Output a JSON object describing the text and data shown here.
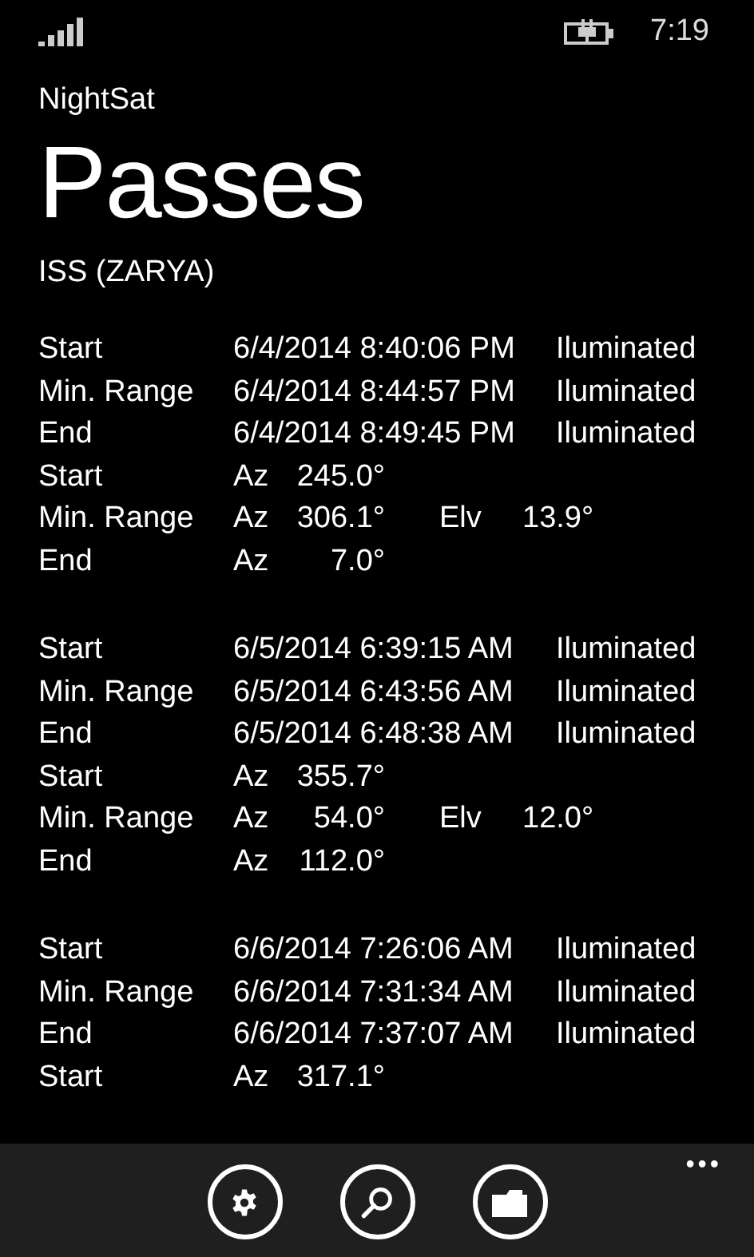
{
  "status_bar": {
    "time": "7:19"
  },
  "app_name": "NightSat",
  "page_title": "Passes",
  "satellite": "ISS (ZARYA)",
  "passes": [
    {
      "times": [
        {
          "label": "Start",
          "time": "6/4/2014 8:40:06 PM",
          "status": "Iluminated"
        },
        {
          "label": "Min. Range",
          "time": "6/4/2014 8:44:57 PM",
          "status": "Iluminated"
        },
        {
          "label": "End",
          "time": "6/4/2014 8:49:45 PM",
          "status": "Iluminated"
        }
      ],
      "angles": [
        {
          "label": "Start",
          "az_label": "Az",
          "az": "245.0°"
        },
        {
          "label": "Min. Range",
          "az_label": "Az",
          "az": "306.1°",
          "elv_label": "Elv",
          "elv": "13.9°"
        },
        {
          "label": "End",
          "az_label": "Az",
          "az": "7.0°"
        }
      ]
    },
    {
      "times": [
        {
          "label": "Start",
          "time": "6/5/2014 6:39:15 AM",
          "status": "Iluminated"
        },
        {
          "label": "Min. Range",
          "time": "6/5/2014 6:43:56 AM",
          "status": "Iluminated"
        },
        {
          "label": "End",
          "time": "6/5/2014 6:48:38 AM",
          "status": "Iluminated"
        }
      ],
      "angles": [
        {
          "label": "Start",
          "az_label": "Az",
          "az": "355.7°"
        },
        {
          "label": "Min. Range",
          "az_label": "Az",
          "az": "54.0°",
          "elv_label": "Elv",
          "elv": "12.0°"
        },
        {
          "label": "End",
          "az_label": "Az",
          "az": "112.0°"
        }
      ]
    },
    {
      "times": [
        {
          "label": "Start",
          "time": "6/6/2014 7:26:06 AM",
          "status": "Iluminated"
        },
        {
          "label": "Min. Range",
          "time": "6/6/2014 7:31:34 AM",
          "status": "Iluminated"
        },
        {
          "label": "End",
          "time": "6/6/2014 7:37:07 AM",
          "status": "Iluminated"
        }
      ],
      "angles": [
        {
          "label": "Start",
          "az_label": "Az",
          "az": "317.1°"
        }
      ]
    }
  ],
  "app_bar": {
    "more": "•••"
  }
}
